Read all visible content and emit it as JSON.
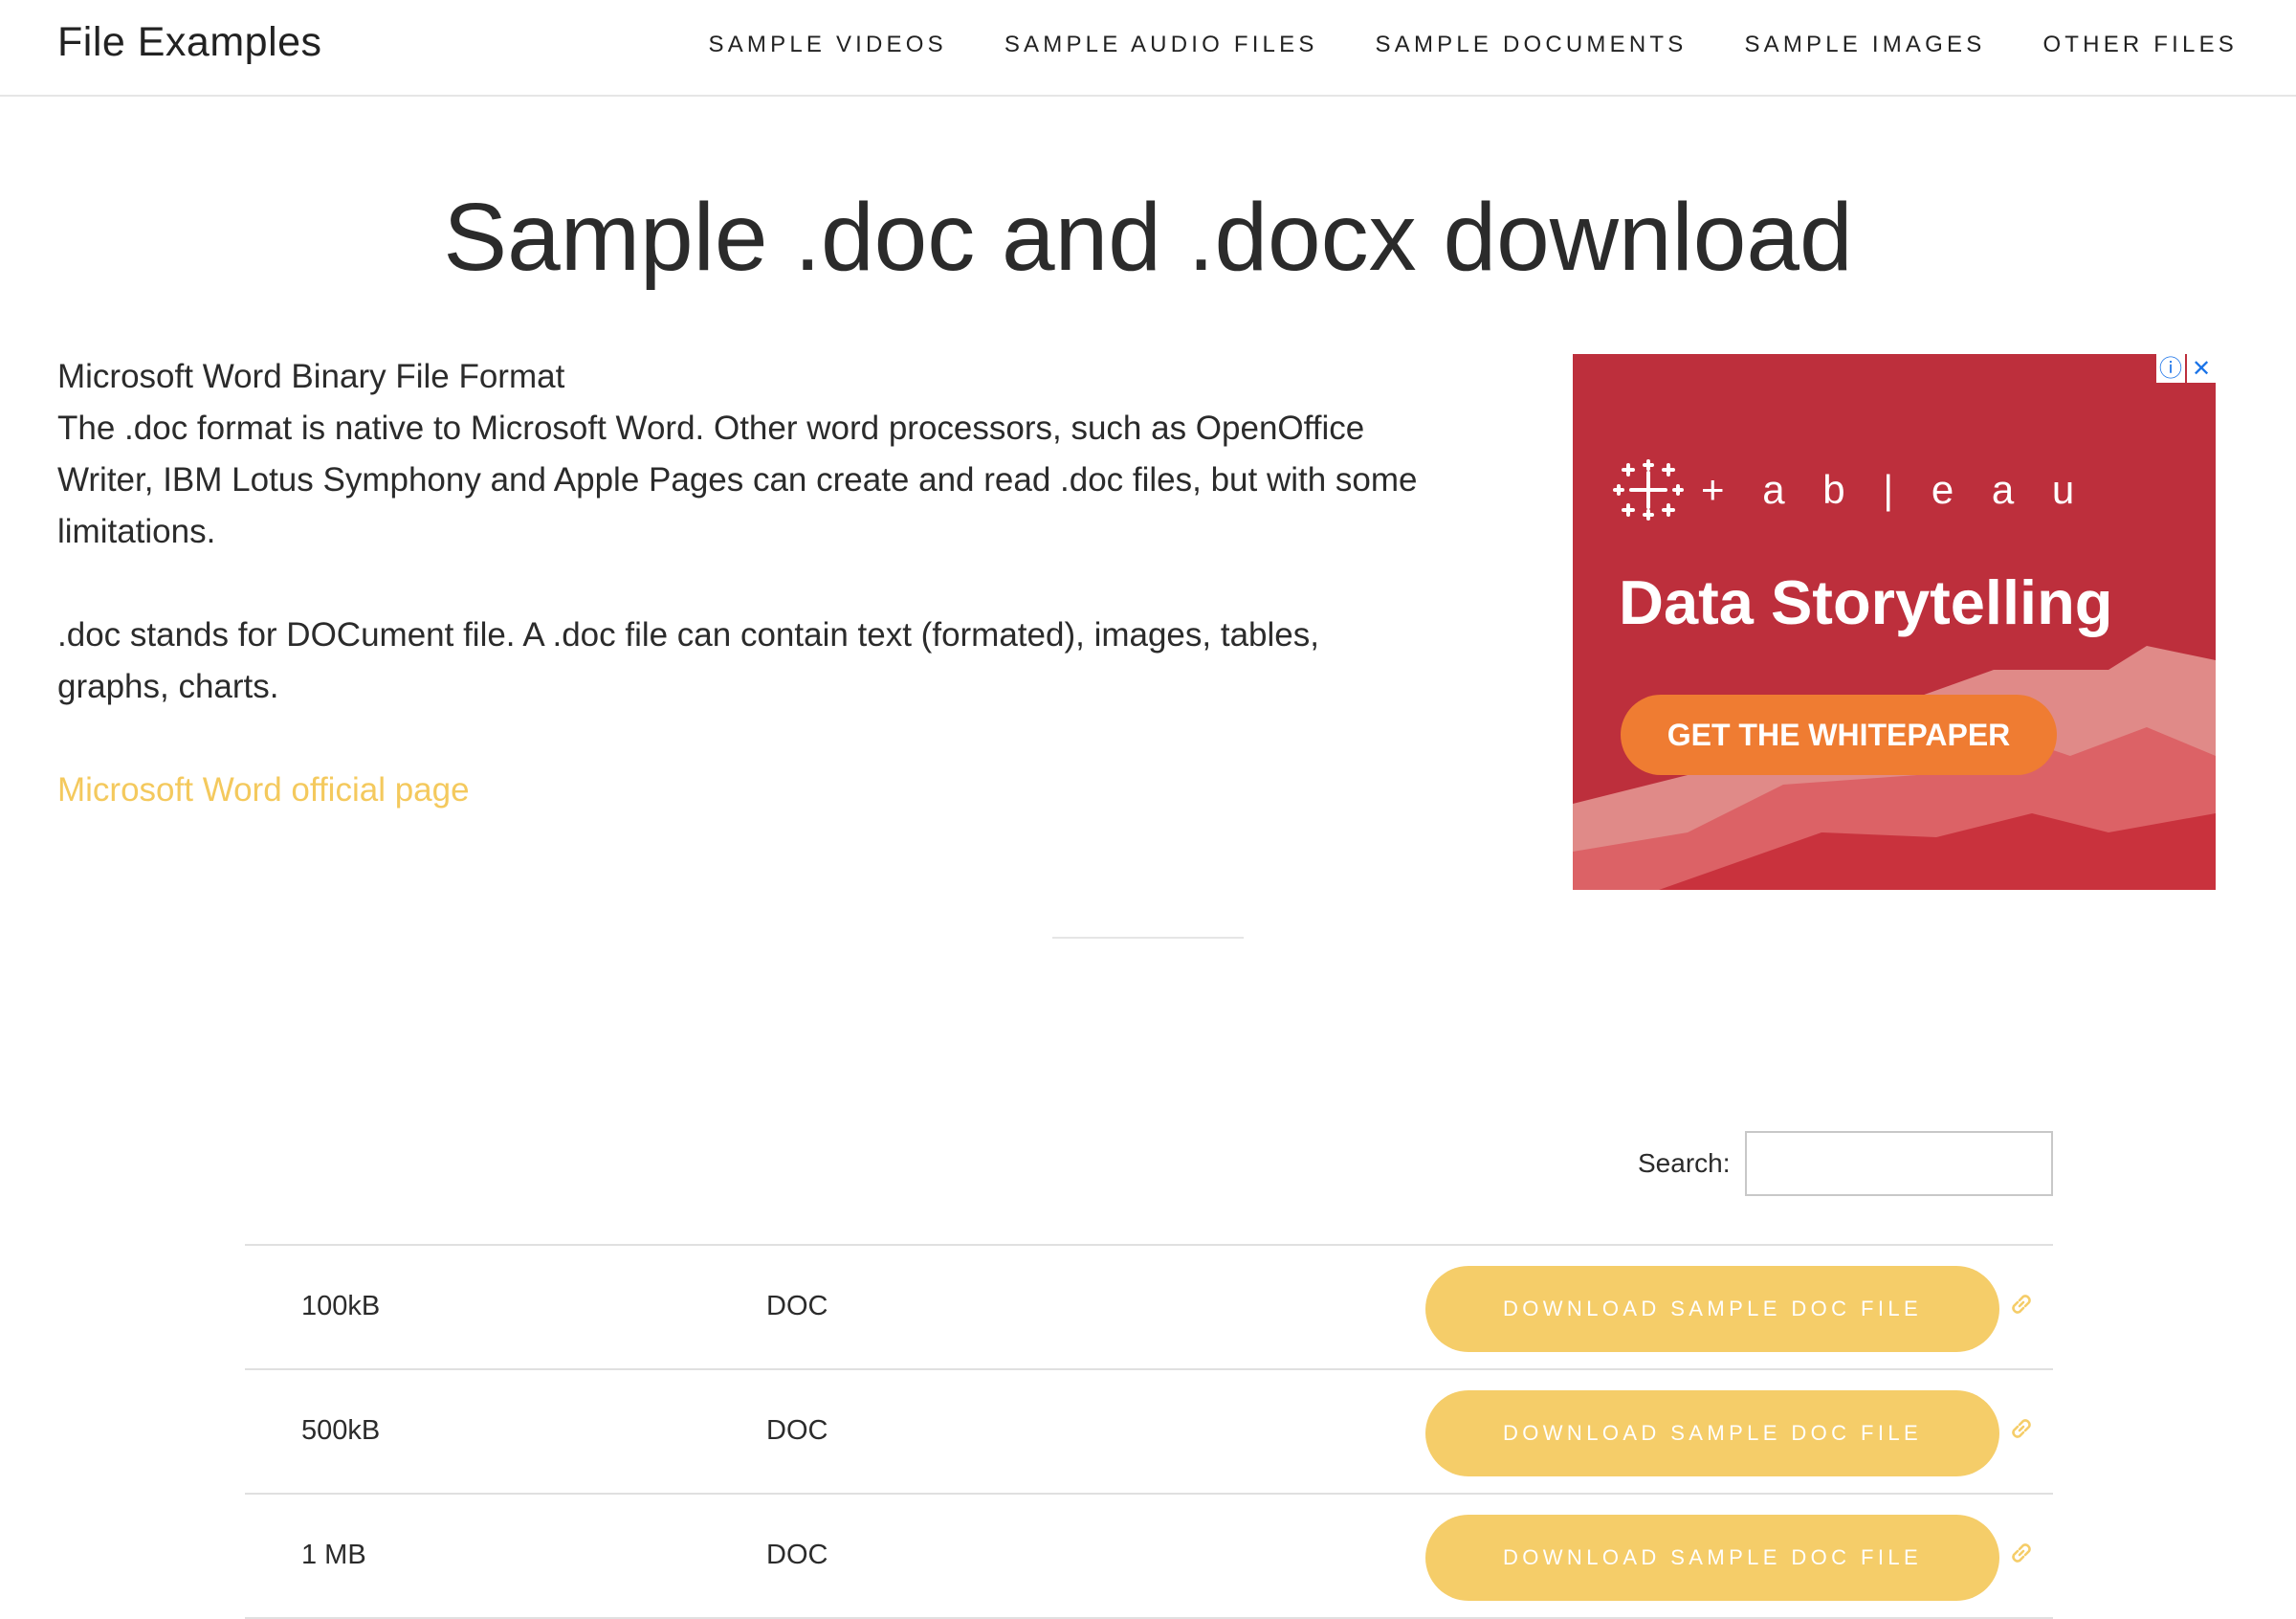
{
  "header": {
    "site_title": "File Examples",
    "nav": [
      {
        "label": "SAMPLE VIDEOS"
      },
      {
        "label": "SAMPLE AUDIO FILES"
      },
      {
        "label": "SAMPLE DOCUMENTS"
      },
      {
        "label": "SAMPLE IMAGES"
      },
      {
        "label": "OTHER FILES"
      }
    ]
  },
  "page": {
    "title": "Sample .doc and .docx download"
  },
  "intro": {
    "heading": "Microsoft Word Binary File Format",
    "paragraph1": "The .doc format is native to Microsoft Word. Other word processors, such as OpenOffice Writer, IBM Lotus Symphony and Apple Pages can create and read .doc files, but with some limitations.",
    "paragraph2": ".doc stands for DOCument file. A .doc file can contain text (formated), images, tables, graphs, charts.",
    "link_label": "Microsoft Word official page"
  },
  "ad": {
    "brand": "+ a b | e a u",
    "headline": "Data Storytelling",
    "cta": "GET THE WHITEPAPER",
    "info_icon": "info-icon",
    "close_icon": "close-icon"
  },
  "search": {
    "label": "Search:",
    "value": "",
    "placeholder": ""
  },
  "table": {
    "rows": [
      {
        "size": "100kB",
        "type": "DOC",
        "button": "DOWNLOAD SAMPLE DOC FILE"
      },
      {
        "size": "500kB",
        "type": "DOC",
        "button": "DOWNLOAD SAMPLE DOC FILE"
      },
      {
        "size": "1 MB",
        "type": "DOC",
        "button": "DOWNLOAD SAMPLE DOC FILE"
      }
    ]
  },
  "colors": {
    "accent": "#f5cd69",
    "link": "#f4c95d",
    "ad_background": "#bd2f3c",
    "ad_cta": "#ef7c32"
  }
}
